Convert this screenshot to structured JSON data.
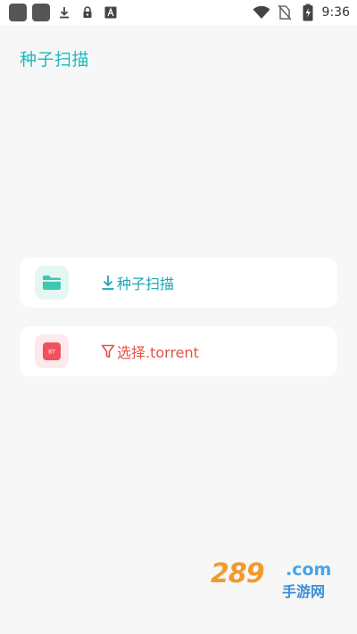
{
  "status_bar": {
    "time": "9:36",
    "left_icons": [
      "app-icon",
      "app-icon",
      "download-icon",
      "lock-icon",
      "font-icon"
    ],
    "right_icons": [
      "wifi-icon",
      "no-sim-icon",
      "battery-charging-icon"
    ]
  },
  "header": {
    "title": "种子扫描"
  },
  "actions": {
    "scan": {
      "label": "种子扫描",
      "icon": "folder-icon",
      "accent": "#1aa9b2"
    },
    "select": {
      "label": "选择.torrent",
      "icon": "bt-file-icon",
      "accent": "#e35245"
    }
  },
  "watermark": {
    "number": "289",
    "domain": ".com",
    "subtitle": "手游网"
  }
}
